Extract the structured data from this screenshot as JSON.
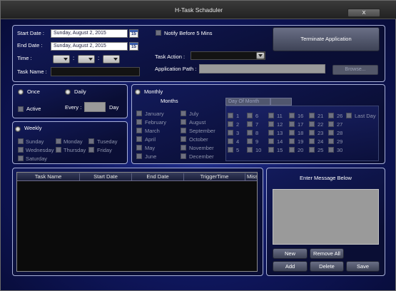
{
  "window": {
    "title": "H-Task Schaduler",
    "close_label": "X"
  },
  "top": {
    "start_date_label": "Start Date :",
    "start_date_value": "Sunday, August 2, 2015",
    "end_date_label": "End Date :",
    "end_date_value": "Sunday, August 2, 2015",
    "calendar_day": "15",
    "time_label": "Time :",
    "time_sep": ":",
    "task_name_label": "Task Name :",
    "notify_label": "Notify Before 5 Mins",
    "task_action_label": "Task Action :",
    "app_path_label": "Application Path :",
    "browse_label": "Browse...",
    "terminate_label": "Terminate Application"
  },
  "schedule": {
    "once_label": "Once",
    "active_label": "Active",
    "daily_label": "Daily",
    "every_label": "Every :",
    "day_label": "Day",
    "weekly_label": "Weekly",
    "weekdays": [
      "Sunday",
      "Monday",
      "Tuseday",
      "Wednesday",
      "Thursday",
      "Friday",
      "Saturday"
    ],
    "monthly_label": "Monthly",
    "months_header": "Months",
    "months": [
      "January",
      "February",
      "March",
      "April",
      "May",
      "June",
      "July",
      "August",
      "September",
      "October",
      "November",
      "December"
    ],
    "day_of_month_tab": "Day Of Month",
    "days": [
      "1",
      "2",
      "3",
      "4",
      "5",
      "6",
      "7",
      "8",
      "9",
      "10",
      "11",
      "12",
      "13",
      "14",
      "15",
      "16",
      "17",
      "18",
      "19",
      "20",
      "21",
      "22",
      "23",
      "24",
      "25",
      "26",
      "27",
      "28",
      "29",
      "30"
    ],
    "last_day_label": "Last Day"
  },
  "table": {
    "columns": [
      "Task Name",
      "Start Date",
      "End Date",
      "TriggerTime",
      "Miss"
    ]
  },
  "message": {
    "header": "Enter Message Below",
    "new_label": "New",
    "remove_all_label": "Remove All",
    "add_label": "Add",
    "delete_label": "Delete",
    "save_label": "Save"
  },
  "colors": {
    "accent": "#1e2c8a",
    "panel_border": "#a8b0d8",
    "button": "#5a5f78"
  }
}
